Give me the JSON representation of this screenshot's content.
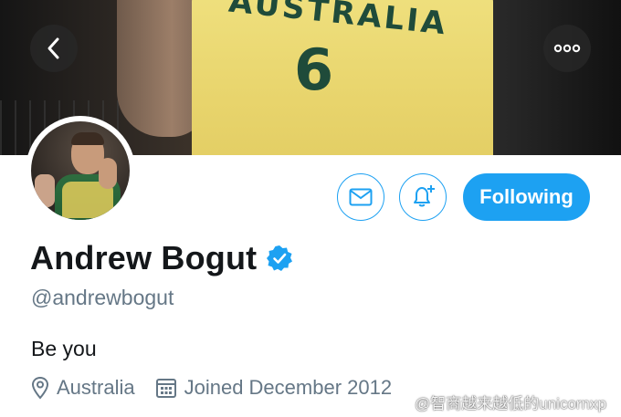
{
  "header": {
    "back_icon": "chevron-left-icon",
    "more_icon": "more-horizontal-icon"
  },
  "banner": {
    "jersey_text": "AUSTRALIA",
    "jersey_number": "6"
  },
  "actions": {
    "message_icon": "envelope-icon",
    "notify_icon": "bell-plus-icon",
    "follow_label": "Following"
  },
  "profile": {
    "name": "Andrew Bogut",
    "verified_icon": "verified-badge-icon",
    "handle": "@andrewbogut",
    "bio": "Be you",
    "location": "Australia",
    "joined": "Joined December 2012"
  },
  "watermark": {
    "text": "@智商越来越低的unicornxp"
  },
  "colors": {
    "accent": "#1da1f2",
    "secondary_text": "#657786",
    "primary_text": "#14171a"
  }
}
